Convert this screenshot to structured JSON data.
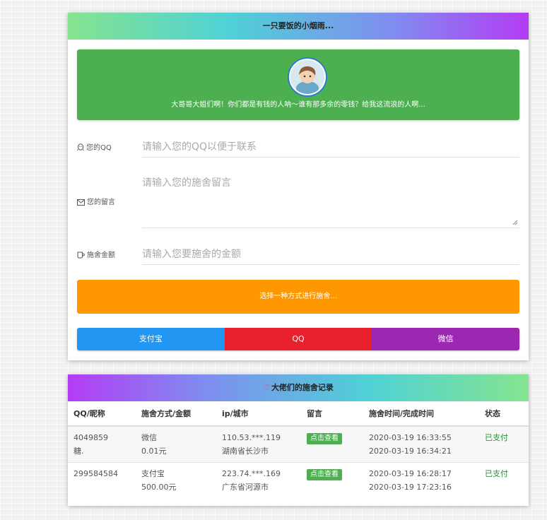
{
  "top_card": {
    "header": "一只要饭的小烟雨...",
    "banner_text": "大哥哥大姐们啊！你们都是有钱的人呐～谁有那多余的零钱？给我这流浪的人啊...",
    "fields": {
      "qq_label": "您的QQ",
      "qq_placeholder": "请输入您的QQ以便于联系",
      "message_label": "您的留言",
      "message_placeholder": "请输入您的施舍留言",
      "amount_label": "施舍金额",
      "amount_placeholder": "请输入您要施舍的金额"
    },
    "choose_button": "选择一种方式进行施舍...",
    "payment_methods": [
      {
        "label": "支付宝",
        "color": "#2196f3"
      },
      {
        "label": "QQ",
        "color": "#e8202d"
      },
      {
        "label": "微信",
        "color": "#9c27b0"
      }
    ]
  },
  "records": {
    "header": "大佬们的施舍记录",
    "columns": [
      "QQ/昵称",
      "施舍方式/金额",
      "ip/城市",
      "留言",
      "施舍时间/完成时间",
      "状态"
    ],
    "rows": [
      {
        "qq": "4049859",
        "nick": "糖.",
        "method": "微信",
        "amount": "0.01元",
        "ip": "110.53.***.119",
        "city": "湖南省长沙市",
        "message_button": "点击查看",
        "time": "2020-03-19 16:33:55",
        "done": "2020-03-19 16:34:21",
        "status": "已支付"
      },
      {
        "qq": "299584584",
        "nick": "",
        "method": "支付宝",
        "amount": "500.00元",
        "ip": "223.74.***.169",
        "city": "广东省河源市",
        "message_button": "点击查看",
        "time": "2020-03-19 16:28:17",
        "done": "2020-03-19 17:23:16",
        "status": "已支付"
      }
    ]
  },
  "icons": [
    "qq-icon",
    "mail-icon",
    "cup-icon",
    "heart-icon"
  ],
  "colors": {
    "green": "#4caf50",
    "orange": "#ff9800",
    "status_green": "#2e8b3a"
  }
}
